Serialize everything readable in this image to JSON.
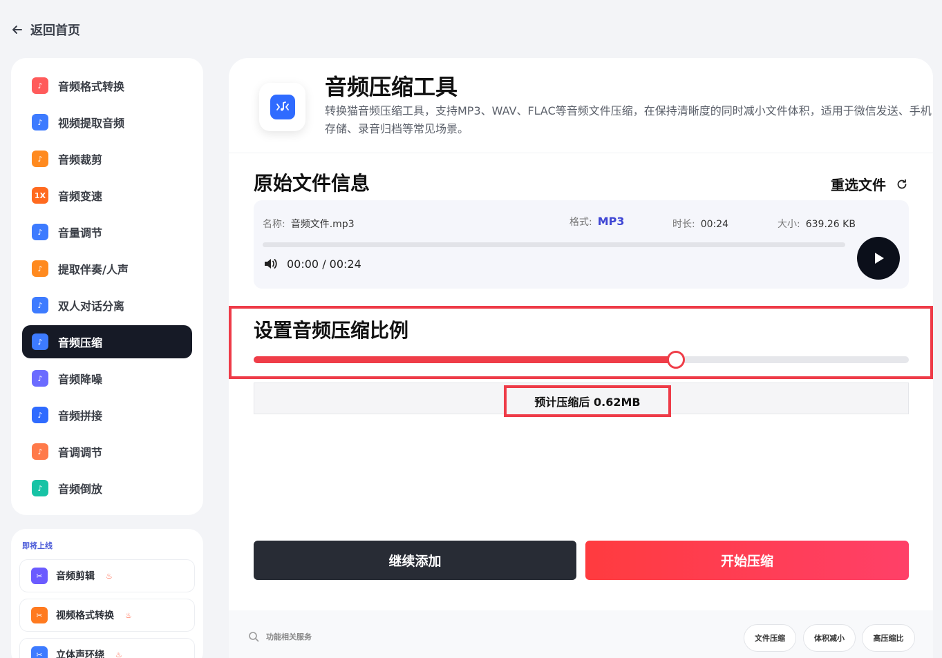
{
  "nav": {
    "back_label": "返回首页"
  },
  "sidebar": {
    "items": [
      {
        "label": "音频格式转换",
        "icon": "format-convert-icon",
        "color": "#ff5b5b"
      },
      {
        "label": "视频提取音频",
        "icon": "video-extract-icon",
        "color": "#3d7bff"
      },
      {
        "label": "音频裁剪",
        "icon": "audio-cut-icon",
        "color": "#ff8a1f"
      },
      {
        "label": "音频变速",
        "icon": "speed-icon",
        "color": "#ff6a1f",
        "glyph": "1X"
      },
      {
        "label": "音量调节",
        "icon": "volume-icon",
        "color": "#3d7bff"
      },
      {
        "label": "提取伴奏/人声",
        "icon": "vocal-extract-icon",
        "color": "#ff8a1f"
      },
      {
        "label": "双人对话分离",
        "icon": "dialog-split-icon",
        "color": "#3d7bff"
      },
      {
        "label": "音频压缩",
        "icon": "audio-compress-icon",
        "color": "#3d7bff",
        "active": true
      },
      {
        "label": "音频降噪",
        "icon": "denoise-icon",
        "color": "#6b6bff"
      },
      {
        "label": "音频拼接",
        "icon": "audio-join-icon",
        "color": "#2f6bff"
      },
      {
        "label": "音调调节",
        "icon": "pitch-icon",
        "color": "#ff7a4a"
      },
      {
        "label": "音频倒放",
        "icon": "reverse-icon",
        "color": "#17c3a5"
      }
    ]
  },
  "coming": {
    "title": "即将上线",
    "items": [
      {
        "label": "音频剪辑",
        "icon": "scissors-icon",
        "color": "#6b5bff"
      },
      {
        "label": "视频格式转换",
        "icon": "video-convert-icon",
        "color": "#ff7a1f"
      },
      {
        "label": "立体声环绕",
        "icon": "surround-icon",
        "color": "#3d7bff"
      }
    ]
  },
  "tool": {
    "title": "音频压缩工具",
    "description": "转换猫音频压缩工具，支持MP3、WAV、FLAC等音频文件压缩，在保持清晰度的同时减小文件体积，适用于微信发送、手机存储、录音归档等常见场景。"
  },
  "file_info": {
    "section_title": "原始文件信息",
    "reselect_label": "重选文件",
    "name_label": "名称:",
    "name_value": "音频文件.mp3",
    "format_label": "格式:",
    "format_value": "MP3",
    "duration_label": "时长:",
    "duration_value": "00:24",
    "size_label": "大小:",
    "size_value": "639.26 KB",
    "player_time": "00:00 / 00:24",
    "playback_progress": 0
  },
  "compression": {
    "title": "设置音频压缩比例",
    "ratio": 0.645,
    "estimate": "预计压缩后 0.62MB"
  },
  "actions": {
    "add_more": "继续添加",
    "start": "开始压缩"
  },
  "footer": {
    "related": "功能相关服务",
    "tags": [
      "文件压缩",
      "体积减小",
      "高压缩比"
    ]
  },
  "colors": {
    "accent": "#ef3d48",
    "dark": "#161a26",
    "format": "#3f46d4"
  }
}
